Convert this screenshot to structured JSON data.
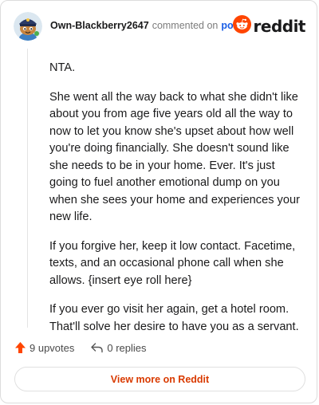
{
  "header": {
    "username": "Own-Blackberry2647",
    "commented_text": "commented on",
    "post_link": "post",
    "brand": "reddit"
  },
  "comment": {
    "paragraphs": [
      "NTA.",
      "She went all the way back to what she didn't like about you from age five years old all the way to now to let you know she's upset about how well you're doing financially. She doesn't sound like she needs to be in your home. Ever. It's just going to fuel another emotional dump on you when she sees your home and experiences your new life.",
      "If you forgive her, keep it low contact. Facetime, texts, and an occasional phone call when she allows. {insert eye roll here}",
      "If you ever go visit her again, get a hotel room. That'll solve her desire to have you as a servant."
    ]
  },
  "actions": {
    "upvotes": "9 upvotes",
    "replies": "0 replies"
  },
  "footer": {
    "view_more": "View more on Reddit"
  },
  "colors": {
    "accent": "#ff4500",
    "link": "#1a5ee6",
    "view_more": "#d93a00"
  },
  "icons": {
    "avatar": "snoo-avatar-icon",
    "brand": "reddit-logo-icon",
    "upvote": "upvote-arrow-icon",
    "reply": "reply-arrow-icon"
  }
}
